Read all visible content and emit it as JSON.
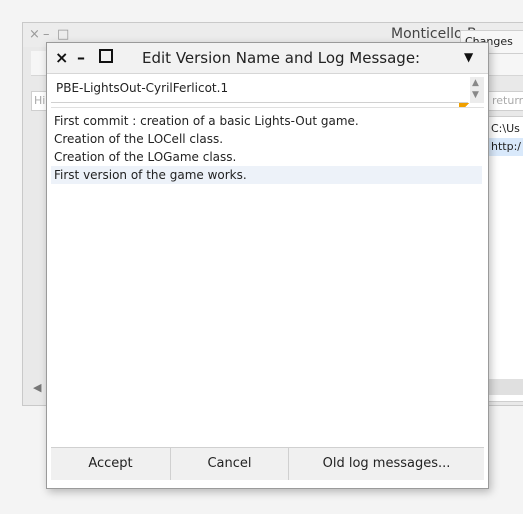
{
  "background_window": {
    "title": "Monticello Browser",
    "close_glyph": "×",
    "minimize_glyph": "–",
    "maximize_glyph": "□",
    "changes_button_label": "Changes",
    "filter_left_placeholder": "Hi",
    "filter_right_placeholder": "return",
    "repositories": [
      "C:\\Us",
      "http:/"
    ],
    "scroll_left_glyph": "◀"
  },
  "dialog": {
    "title": "Edit Version Name and Log Message:",
    "close_glyph": "×",
    "minimize_glyph": "–",
    "menu_glyph": "▼",
    "version_name": "PBE-LightsOut-CyrilFerlicot.1",
    "scroll_up_glyph": "▲",
    "scroll_down_glyph": "▼",
    "log_lines": [
      "First commit : creation of a basic Lights-Out game.",
      "Creation of the LOCell class.",
      "Creation of the LOGame class.",
      "First version of the game works."
    ],
    "buttons": {
      "accept": "Accept",
      "cancel": "Cancel",
      "old_log": "Old log messages..."
    }
  },
  "colors": {
    "accent_corner": "#f0a000",
    "selection_highlight": "#d9e9fb"
  }
}
